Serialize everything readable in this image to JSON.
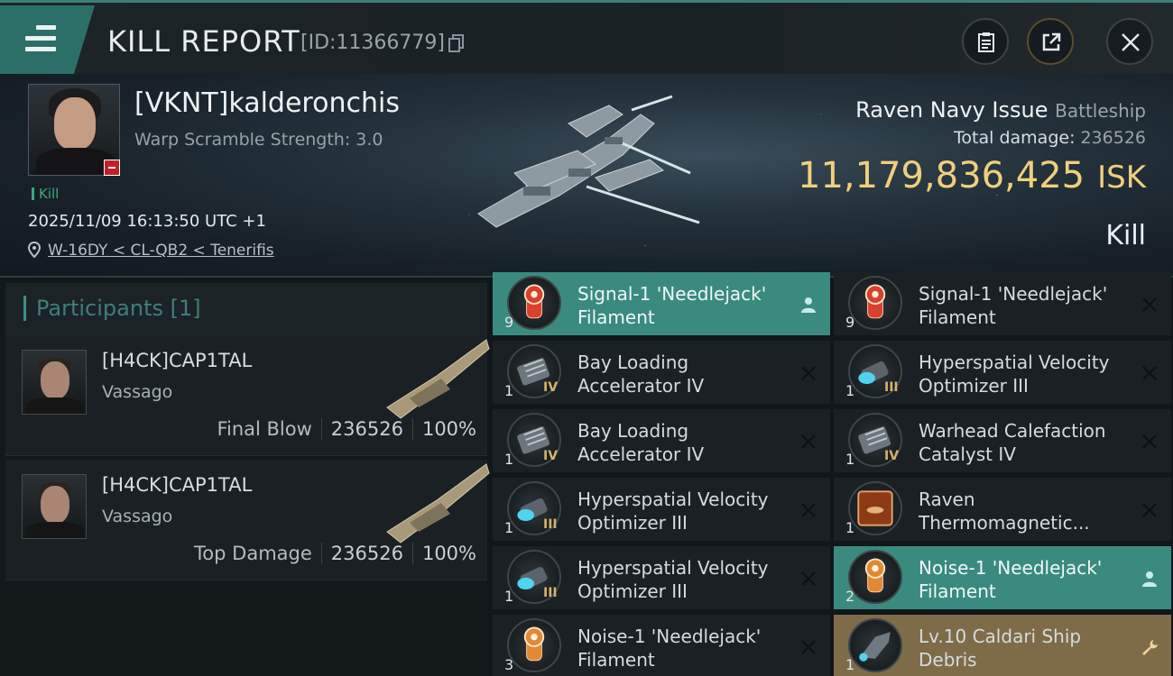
{
  "header": {
    "title": "KILL REPORT",
    "kill_id": "[ID:11366779]"
  },
  "victim": {
    "name": "[VKNT]kalderonchis",
    "warp_scramble": "Warp Scramble Strength: 3.0",
    "kill_tag": "Kill",
    "datetime": "2025/11/09 16:13:50 UTC +1",
    "location": "W-16DY < CL-QB2 < Tenerifis",
    "ship_name": "Raven Navy Issue",
    "ship_class": "Battleship",
    "total_damage_label": "Total damage:",
    "total_damage": "236526",
    "isk_value": "11,179,836,425",
    "isk_unit": "ISK",
    "result": "Kill"
  },
  "participants": {
    "title": "Participants",
    "count": "[1]",
    "rows": [
      {
        "name": "[H4CK]CAP1TAL",
        "ship": "Vassago",
        "label": "Final Blow",
        "damage": "236526",
        "percent": "100%"
      },
      {
        "name": "[H4CK]CAP1TAL",
        "ship": "Vassago",
        "label": "Top Damage",
        "damage": "236526",
        "percent": "100%"
      }
    ]
  },
  "items": {
    "left": [
      {
        "name1": "Signal-1 'Needlejack'",
        "name2": "Filament",
        "qty": "9",
        "meta": "",
        "state": "dropped",
        "icon": "red-filament-icon"
      },
      {
        "name1": "Bay Loading",
        "name2": "Accelerator IV",
        "qty": "1",
        "meta": "IV",
        "state": "destroyed",
        "icon": "launcher-module-icon"
      },
      {
        "name1": "Bay Loading",
        "name2": "Accelerator IV",
        "qty": "1",
        "meta": "IV",
        "state": "destroyed",
        "icon": "launcher-module-icon"
      },
      {
        "name1": "Hyperspatial Velocity",
        "name2": "Optimizer III",
        "qty": "1",
        "meta": "III",
        "state": "destroyed",
        "icon": "rig-icon"
      },
      {
        "name1": "Hyperspatial Velocity",
        "name2": "Optimizer III",
        "qty": "1",
        "meta": "III",
        "state": "destroyed",
        "icon": "rig-icon"
      },
      {
        "name1": "Noise-1 'Needlejack'",
        "name2": "Filament",
        "qty": "3",
        "meta": "",
        "state": "destroyed",
        "icon": "orange-filament-icon"
      }
    ],
    "right": [
      {
        "name1": "Signal-1 'Needlejack'",
        "name2": "Filament",
        "qty": "9",
        "meta": "",
        "state": "destroyed",
        "icon": "red-filament-icon"
      },
      {
        "name1": "Hyperspatial Velocity",
        "name2": "Optimizer III",
        "qty": "1",
        "meta": "III",
        "state": "destroyed",
        "icon": "rig-icon"
      },
      {
        "name1": "Warhead Calefaction",
        "name2": "Catalyst IV",
        "qty": "1",
        "meta": "IV",
        "state": "destroyed",
        "icon": "launcher-module-icon"
      },
      {
        "name1": "Raven",
        "name2": "Thermomagnetic...",
        "qty": "1",
        "meta": "",
        "state": "destroyed",
        "icon": "blueprint-icon"
      },
      {
        "name1": "Noise-1 'Needlejack'",
        "name2": "Filament",
        "qty": "2",
        "meta": "",
        "state": "dropped",
        "icon": "orange-filament-icon"
      },
      {
        "name1": "Lv.10 Caldari Ship",
        "name2": "Debris",
        "qty": "1",
        "meta": "",
        "state": "salvage",
        "icon": "debris-icon"
      }
    ]
  },
  "colors": {
    "accent": "#3a8a80",
    "isk": "#f1cf7c",
    "salvage": "#7e6c48",
    "kill_green": "#3fa87d"
  }
}
